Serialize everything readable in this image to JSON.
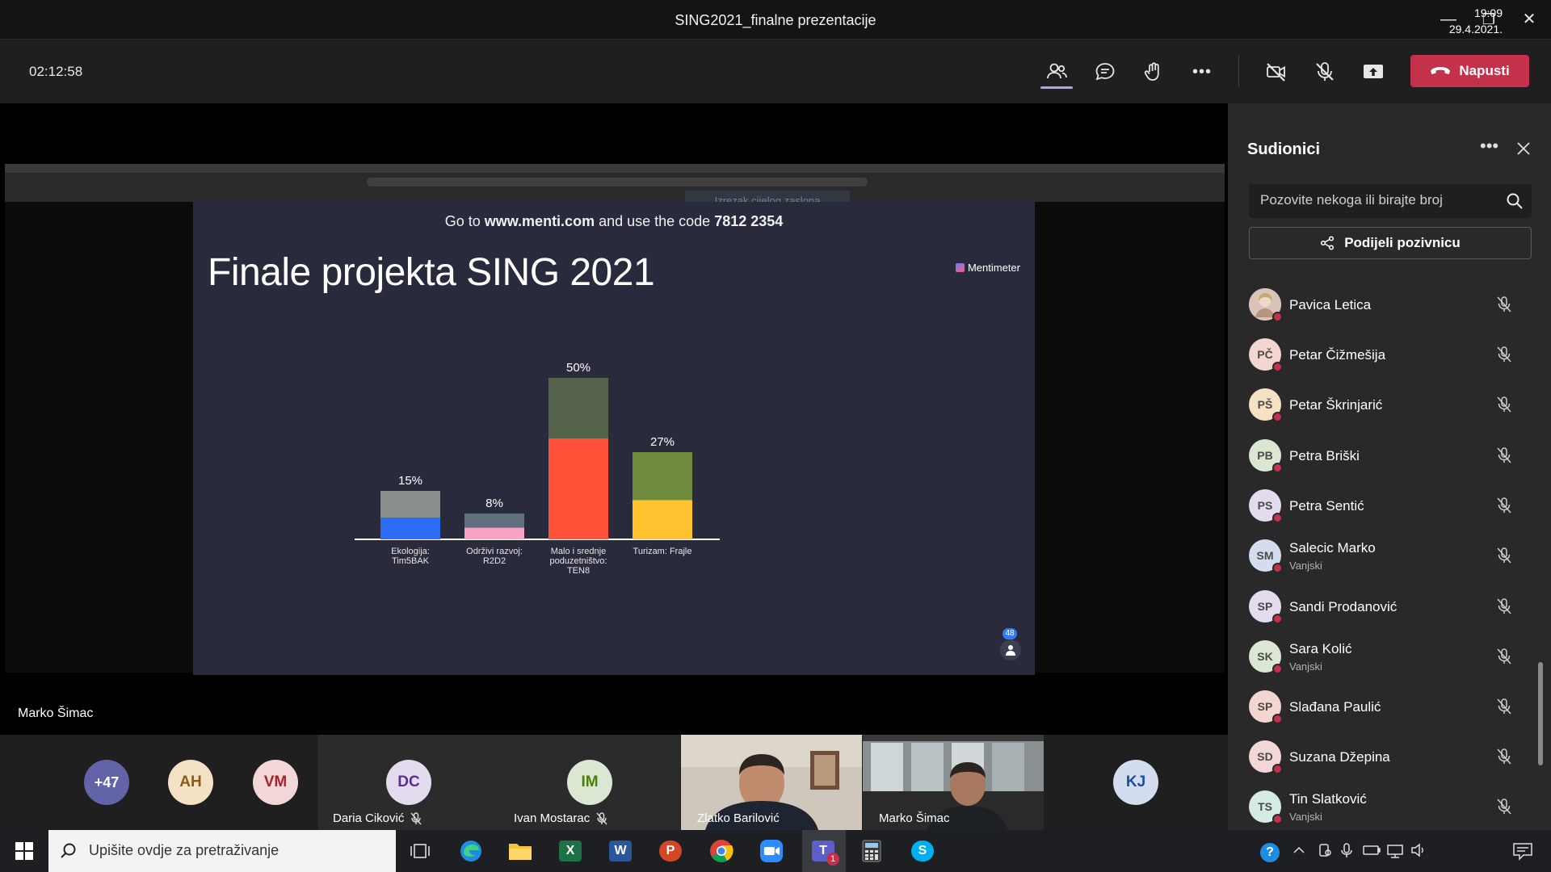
{
  "window": {
    "title": "SING2021_finalne prezentacije",
    "minimize_glyph": "—",
    "restore_glyph": "❐",
    "close_glyph": "✕"
  },
  "toolbar": {
    "timer": "02:12:58",
    "icons": [
      "people-icon",
      "chat-icon",
      "raise-hand-icon",
      "more-icon",
      "camera-off-icon",
      "mic-off-icon",
      "share-screen-icon"
    ],
    "more_glyph": "•••",
    "leave_label": "Napusti",
    "leave_color": "#c4314b"
  },
  "stage": {
    "crop_tooltip": "Izrezak cijelog zaslona",
    "speaker_name": "Marko Šimac",
    "response_count": "48"
  },
  "slide": {
    "code_prefix": "Go to ",
    "code_url": "www.menti.com",
    "code_middle": " and use the code ",
    "code_number": "7812 2354",
    "title": "Finale projekta SING 2021",
    "brand": "Mentimeter",
    "background": "#292b3c"
  },
  "chart_data": {
    "type": "bar",
    "title": "Finale projekta SING 2021",
    "categories": [
      "Ekologija: Tim5BAK",
      "Održivi razvoj: R2D2",
      "Malo i srednje poduzetništvo: TEN8",
      "Turizam: Frajle"
    ],
    "category_lines": [
      [
        "Ekologija:",
        "Tim5BAK"
      ],
      [
        "Održivi razvoj:",
        "R2D2"
      ],
      [
        "Malo i srednje",
        "poduzetništvo:",
        "TEN8"
      ],
      [
        "Turizam: Frajle"
      ]
    ],
    "values": [
      15,
      8,
      50,
      27
    ],
    "value_labels": [
      "15%",
      "8%",
      "50%",
      "27%"
    ],
    "colors": [
      "#2d6cf5",
      "#f7a3c4",
      "#ff5238",
      "#ffc22e"
    ],
    "ylim": [
      0,
      50
    ],
    "grid": false,
    "legend": "none"
  },
  "gallery": {
    "overflow": "+47",
    "tiles": [
      {
        "initials": "AH",
        "name": ""
      },
      {
        "initials": "VM",
        "name": ""
      },
      {
        "initials": "DC",
        "name": "Daria Ciković"
      },
      {
        "initials": "IM",
        "name": "Ivan Mostarac"
      },
      {
        "initials": "",
        "name": "Zlatko Barilović"
      },
      {
        "initials": "",
        "name": "Marko Šimac"
      },
      {
        "initials": "KJ",
        "name": ""
      }
    ]
  },
  "panel": {
    "title": "Sudionici",
    "more_glyph": "•••",
    "search_placeholder": "Pozovite nekoga ili birajte broj",
    "share_label": "Podijeli pozivnicu",
    "participants": [
      {
        "initials": "",
        "name": "Pavica Letica",
        "sub": "",
        "bg": "#d9c4b8"
      },
      {
        "initials": "PČ",
        "name": "Petar Čižmešija",
        "sub": "",
        "bg": "#f3d6d0"
      },
      {
        "initials": "PŠ",
        "name": "Petar Škrinjarić",
        "sub": "",
        "bg": "#f5e2c4"
      },
      {
        "initials": "PB",
        "name": "Petra Briški",
        "sub": "",
        "bg": "#dbe7d3"
      },
      {
        "initials": "PS",
        "name": "Petra Sentić",
        "sub": "",
        "bg": "#e3dcef"
      },
      {
        "initials": "SM",
        "name": "Salecic Marko",
        "sub": "Vanjski",
        "bg": "#d4ddf0"
      },
      {
        "initials": "SP",
        "name": "Sandi Prodanović",
        "sub": "",
        "bg": "#e3dcef"
      },
      {
        "initials": "SK",
        "name": "Sara Kolić",
        "sub": "Vanjski",
        "bg": "#dbe7d3"
      },
      {
        "initials": "SP",
        "name": "Slađana Paulić",
        "sub": "",
        "bg": "#f3d6d0"
      },
      {
        "initials": "SD",
        "name": "Suzana Džepina",
        "sub": "",
        "bg": "#f3d6d8"
      },
      {
        "initials": "TS",
        "name": "Tin Slatković",
        "sub": "Vanjski",
        "bg": "#d6ebe6"
      }
    ]
  },
  "taskbar": {
    "search_placeholder": "Upišite ovdje za pretraživanje",
    "apps": [
      "task-view-icon",
      "edge-icon",
      "file-explorer-icon",
      "excel-icon",
      "word-icon",
      "powerpoint-icon",
      "chrome-icon",
      "zoom-icon",
      "teams-icon",
      "calculator-icon",
      "skype-icon"
    ],
    "teams_badge": "1",
    "help_glyph": "?",
    "time": "19:09",
    "date": "29.4.2021."
  }
}
